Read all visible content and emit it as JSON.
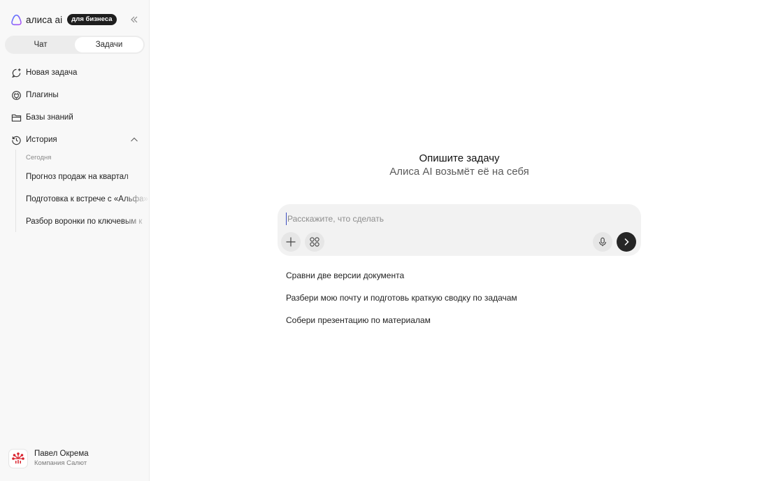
{
  "brand": {
    "name": "алиса ai",
    "badge": "для бизнеса"
  },
  "tabs": [
    {
      "label": "Чат",
      "active": false
    },
    {
      "label": "Задачи",
      "active": true
    }
  ],
  "nav": {
    "new_task": "Новая задача",
    "plugins": "Плагины",
    "knowledge": "Базы знаний",
    "history": "История"
  },
  "history": {
    "group": "Сегодня",
    "items": [
      "Прогноз продаж на квартал",
      "Подготовка к встрече с «Альфа»",
      "Разбор воронки по ключевым к"
    ]
  },
  "user": {
    "name": "Павел Окрема",
    "company": "Компания Салют"
  },
  "hero": {
    "title": "Опишите задачу",
    "subtitle": "Алиса AI возьмёт её на себя"
  },
  "composer": {
    "placeholder": "Расскажите, что сделать",
    "value": ""
  },
  "suggestions": [
    "Сравни две версии документа",
    "Разбери мою почту и подготовь краткую сводку по задачам",
    "Собери презентацию по материалам"
  ],
  "icons": {
    "logo": "alisa-logo-icon",
    "collapse": "double-chevron-left-icon",
    "new_task": "new-chat-icon",
    "plugins": "plugin-icon",
    "knowledge": "folder-icon",
    "history": "history-icon",
    "history_toggle": "chevron-up-icon",
    "attach": "plus-icon",
    "tools": "apps-grid-icon",
    "mic": "microphone-icon",
    "send": "arrow-right-icon"
  },
  "colors": {
    "accent": "#7b5cf5",
    "send_button": "#262626",
    "sidebar_bg": "#f8f8f8",
    "composer_bg": "#f2f2f2"
  }
}
